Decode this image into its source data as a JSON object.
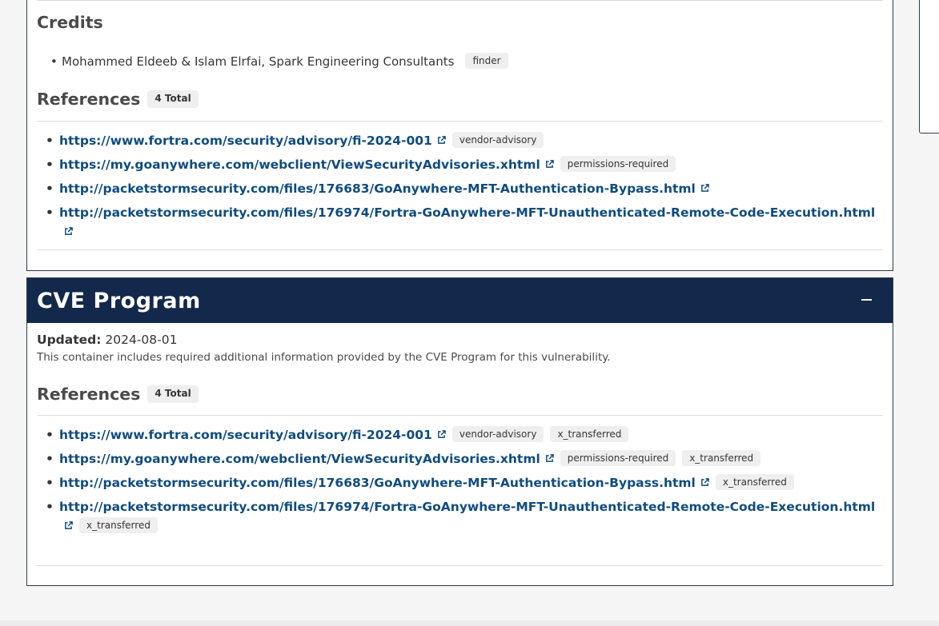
{
  "credits": {
    "heading": "Credits",
    "items": [
      {
        "name": "Mohammed Eldeeb & Islam Elrfai, Spark Engineering Consultants",
        "tag": "finder"
      }
    ]
  },
  "cna_references": {
    "heading": "References",
    "count": "4 Total",
    "items": [
      {
        "url": "https://www.fortra.com/security/advisory/fi-2024-001",
        "tags": [
          "vendor-advisory"
        ]
      },
      {
        "url": "https://my.goanywhere.com/webclient/ViewSecurityAdvisories.xhtml",
        "tags": [
          "permissions-required"
        ]
      },
      {
        "url": "http://packetstormsecurity.com/files/176683/GoAnywhere-MFT-Authentication-Bypass.html",
        "tags": []
      },
      {
        "url": "http://packetstormsecurity.com/files/176974/Fortra-GoAnywhere-MFT-Unauthenticated-Remote-Code-Execution.html",
        "tags": []
      }
    ]
  },
  "cve_program": {
    "title": "CVE Program",
    "updated_label": "Updated:",
    "updated_value": "2024-08-01",
    "description": "This container includes required additional information provided by the CVE Program for this vulnerability.",
    "references_heading": "References",
    "references_count": "4 Total",
    "references": [
      {
        "url": "https://www.fortra.com/security/advisory/fi-2024-001",
        "tags": [
          "vendor-advisory",
          "x_transferred"
        ]
      },
      {
        "url": "https://my.goanywhere.com/webclient/ViewSecurityAdvisories.xhtml",
        "tags": [
          "permissions-required",
          "x_transferred"
        ]
      },
      {
        "url": "http://packetstormsecurity.com/files/176683/GoAnywhere-MFT-Authentication-Bypass.html",
        "tags": [
          "x_transferred"
        ]
      },
      {
        "url": "http://packetstormsecurity.com/files/176974/Fortra-GoAnywhere-MFT-Unauthenticated-Remote-Code-Execution.html",
        "tags": [
          "x_transferred"
        ]
      }
    ]
  },
  "icons": {
    "external_link": "external-link-icon",
    "collapse": "minus-icon"
  },
  "colors": {
    "header_bg": "#13294b",
    "link": "#0f4c81",
    "tag_bg": "#efefef"
  }
}
